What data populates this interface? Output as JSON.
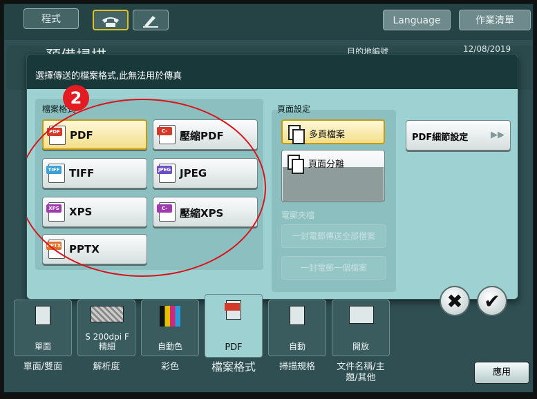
{
  "top": {
    "program_label": "程式",
    "language_label": "Language",
    "job_list_label": "作業清單"
  },
  "header": {
    "background_title": "預備掃描",
    "destination_label": "目的地編號",
    "date": "12/08/2019"
  },
  "dialog": {
    "title": "選擇傳送的檔案格式,此無法用於傳真",
    "file_format": {
      "title": "檔案格式",
      "selected": "PDF",
      "options": [
        {
          "label": "PDF",
          "tag": "PDF",
          "color": "#d43a2a"
        },
        {
          "label": "壓縮PDF",
          "tag": "C-PDF",
          "color": "#d43a2a"
        },
        {
          "label": "TIFF",
          "tag": "TIFF",
          "color": "#3aa0d8"
        },
        {
          "label": "JPEG",
          "tag": "JPEG",
          "color": "#6a4ec8"
        },
        {
          "label": "XPS",
          "tag": "XPS",
          "color": "#a03ab0"
        },
        {
          "label": "壓縮XPS",
          "tag": "C-XPS",
          "color": "#a03ab0"
        },
        {
          "label": "PPTX",
          "tag": "PPTX",
          "color": "#e0702a"
        }
      ]
    },
    "page_settings": {
      "title": "頁面設定",
      "multi_page": "多頁檔案",
      "page_split": "頁面分離"
    },
    "email_attach": {
      "title": "電郵夾檔",
      "all_in_one": "一封電郵傳送全部檔案",
      "one_per_mail": "一封電郵一個檔案"
    },
    "pdf_detail": "PDF細節設定",
    "annotation_number": "2"
  },
  "bottom": {
    "tiles": [
      {
        "value": "單面",
        "caption": "單面/雙面"
      },
      {
        "value": "S 200dpi F 精細",
        "caption": "解析度"
      },
      {
        "value": "自動色",
        "caption": "彩色"
      },
      {
        "value": "PDF",
        "caption": "檔案格式"
      },
      {
        "value": "自動",
        "caption": "掃描規格"
      },
      {
        "value": "開放",
        "caption": "文件名稱/主題/其他"
      }
    ],
    "apply_label": "應用"
  }
}
